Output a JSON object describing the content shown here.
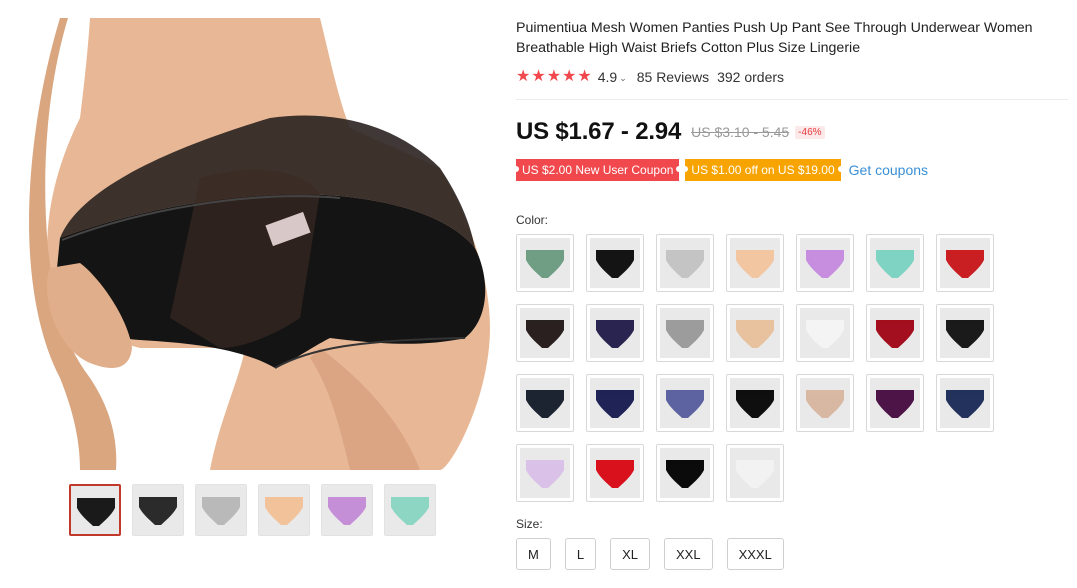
{
  "product": {
    "title": "Puimentiua Mesh Women Panties Push Up Pant See Through Underwear Women Breathable High Waist Briefs Cotton Plus Size Lingerie",
    "rating": "4.9",
    "reviews": "85 Reviews",
    "orders": "392 orders",
    "price": "US $1.67 - 2.94",
    "old_price": "US $3.10 - 5.45",
    "discount": "-46%"
  },
  "coupons": {
    "new_user": "US $2.00 New User Coupon",
    "store": "US $1.00 off on US $19.00",
    "get_link": "Get coupons"
  },
  "labels": {
    "color": "Color:",
    "size": "Size:"
  },
  "colors": {
    "brand_red": "#f0484d",
    "coupon_orange": "#f7a400",
    "link_blue": "#3a8fd6"
  },
  "thumbnails": [
    "#1a1a1a",
    "#2b2b2b",
    "#b9b9b9",
    "#f2c29a",
    "#c58fd8",
    "#8ed6c4"
  ],
  "color_options": [
    "#6f9e84",
    "#141414",
    "#c4c4c4",
    "#f3c6a2",
    "#c78ee0",
    "#7fd3c2",
    "#c91f22",
    "#2a2020",
    "#2a2550",
    "#9c9c9c",
    "#e8c19f",
    "#f4f4f4",
    "#a30f1e",
    "#1a1a1a",
    "#1d2431",
    "#1f2356",
    "#5c63a0",
    "#0f0f0f",
    "#d9b8a3",
    "#4c1447",
    "#22325c",
    "#d9c1e8",
    "#d8111d",
    "#0b0b0b",
    "#f2f2f2"
  ],
  "sizes": [
    "M",
    "L",
    "XL",
    "XXL",
    "XXXL"
  ]
}
